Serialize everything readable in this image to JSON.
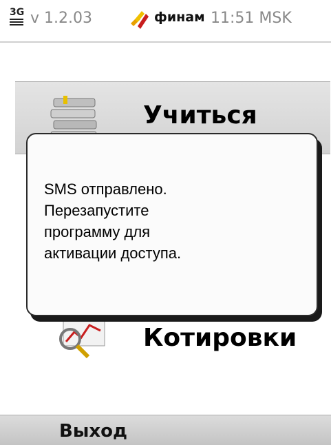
{
  "status_bar": {
    "network": "3G",
    "version": "v 1.2.03",
    "brand": "финам",
    "clock": "11:51 MSK",
    "brand_icon": "finam-flame-icon"
  },
  "menu": {
    "items": [
      {
        "label": "Учиться",
        "icon": "books-icon",
        "selected": true
      },
      {
        "label": "Котировки",
        "icon": "quotes-chart-icon",
        "selected": false
      }
    ]
  },
  "dialog": {
    "message": "SMS отправлено.\nПерезапустите\nпрограмму  для\nактивации доступа."
  },
  "softkeys": {
    "left": "Выход"
  },
  "colors": {
    "accent": "#e8a000",
    "brand_red": "#c81e1e",
    "selection": "#d8d8d8"
  }
}
